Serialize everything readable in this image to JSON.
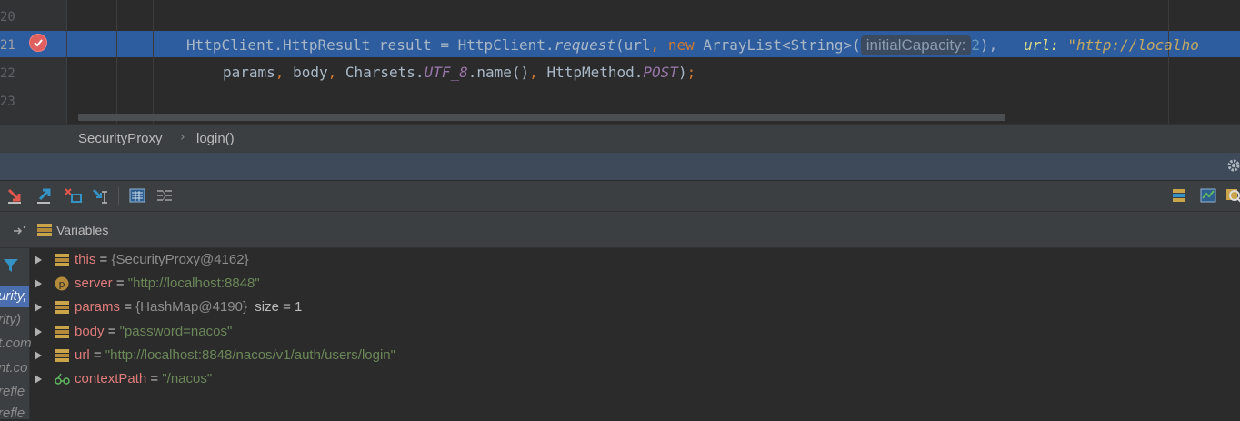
{
  "editor": {
    "line_numbers": [
      "20",
      "21",
      "22",
      "23"
    ],
    "line21": {
      "part1": "HttpClient.HttpResult result = HttpClient.",
      "method": "request",
      "part2": "(url",
      "comma1": ", ",
      "kw_new": "new",
      "part3": " ArrayList<String>(",
      "inlay_hint": "initialCapacity:",
      "inlay_value": "2",
      "part4": "),",
      "debug_hint_label": "url: ",
      "debug_hint_value": "\"http://localho"
    },
    "line22": {
      "part1": "params",
      "c1": ", ",
      "part2": "body",
      "c2": ", ",
      "part3": "Charsets.",
      "constant": "UTF_8",
      "part4": ".name()",
      "c3": ", ",
      "part5": "HttpMethod.",
      "constant2": "POST",
      "part6": ")",
      "semi": ";"
    }
  },
  "breadcrumb": {
    "class_name": "SecurityProxy",
    "separator": "›",
    "method_name": "login()"
  },
  "variables_panel": {
    "title": "Variables",
    "rows": [
      {
        "name": "this",
        "eq": " = ",
        "value": "{SecurityProxy@4162}",
        "extra": "",
        "value_kind": "object",
        "icon": "field-icon"
      },
      {
        "name": "server",
        "eq": " = ",
        "value": "\"http://localhost:8848\"",
        "extra": "",
        "value_kind": "string",
        "icon": "parameter-p-icon"
      },
      {
        "name": "params",
        "eq": " = ",
        "value": "{HashMap@4190}",
        "extra": "  size = 1",
        "value_kind": "object",
        "icon": "field-icon"
      },
      {
        "name": "body",
        "eq": " = ",
        "value": "\"password=nacos\"",
        "extra": "",
        "value_kind": "string",
        "icon": "field-icon"
      },
      {
        "name": "url",
        "eq": " = ",
        "value": "\"http://localhost:8848/nacos/v1/auth/users/login\"",
        "extra": "",
        "value_kind": "string",
        "icon": "field-icon"
      },
      {
        "name": "contextPath",
        "eq": " = ",
        "value": "\"/nacos\"",
        "extra": "",
        "value_kind": "string",
        "icon": "watch-glasses-icon"
      }
    ]
  },
  "frames": {
    "items": [
      "urity,",
      "rity)",
      "t.com",
      "nt.co",
      "refle",
      "refle"
    ]
  },
  "colors": {
    "highlight": "#2d5d9f",
    "var_name": "#e07b7b",
    "string_value": "#6a8759",
    "breakpoint": "#e05e5e"
  }
}
